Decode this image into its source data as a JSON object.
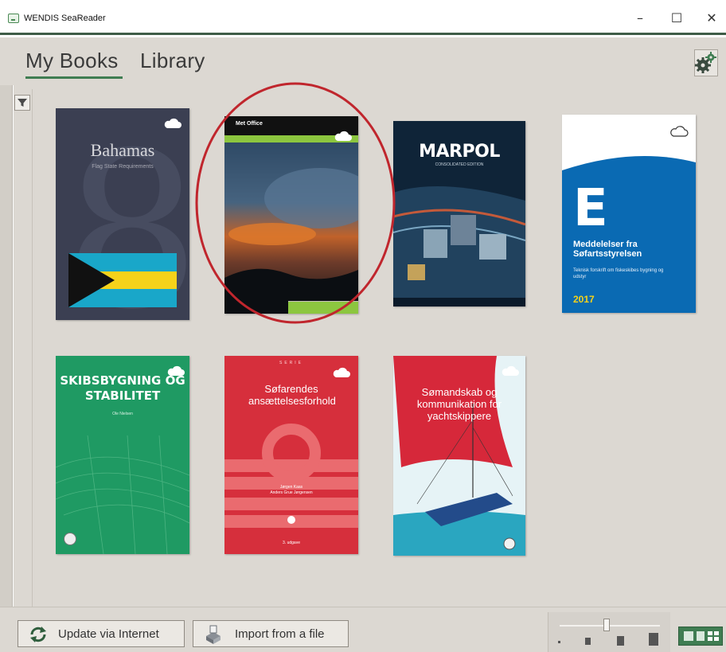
{
  "window": {
    "title": "WENDIS SeaReader",
    "minimize_glyph": "–",
    "maximize_glyph": "☐",
    "close_glyph": "✕"
  },
  "tabs": [
    {
      "label": "My Books",
      "active": true
    },
    {
      "label": "Library",
      "active": false
    }
  ],
  "icons": {
    "settings": "gears-icon",
    "filter": "filter-icon",
    "cloud": "cloud-icon",
    "update": "sync-icon",
    "import": "import-file-icon"
  },
  "books": [
    {
      "title": "Bahamas",
      "subtitle": "Flag State Requirements",
      "cloud": true
    },
    {
      "title": "",
      "brand": "Met Office",
      "cloud": true
    },
    {
      "title": "MARPOL",
      "subtitle": "CONSOLIDATED EDITION",
      "cloud": false
    },
    {
      "title": "Meddelelser fra Søfartsstyrelsen",
      "letter": "E",
      "subtitle": "Teknisk forskrift om fiskeskibes bygning og udstyr",
      "year": "2017",
      "cloud": true
    },
    {
      "title": "SKIBSBYGNING OG STABILITET",
      "author": "Ole Nielsen",
      "cloud": true
    },
    {
      "title": "Søfarendes ansættelsesforhold",
      "series": "SERIE",
      "authors": "Jørgen Kaas\nAnders Grue Jørgensen",
      "edition": "3. udgave",
      "cloud": true
    },
    {
      "title": "Sømandskab og kommunikation for yachtskippere",
      "cloud": true
    }
  ],
  "annotation": {
    "highlighted_book": "Met Office",
    "color": "#c0262d"
  },
  "toolbar": {
    "update_label": "Update via Internet",
    "import_label": "Import from a file",
    "zoom_level": 0.47
  },
  "colors": {
    "accent": "#3f7d52",
    "background": "#dcd8d2"
  }
}
